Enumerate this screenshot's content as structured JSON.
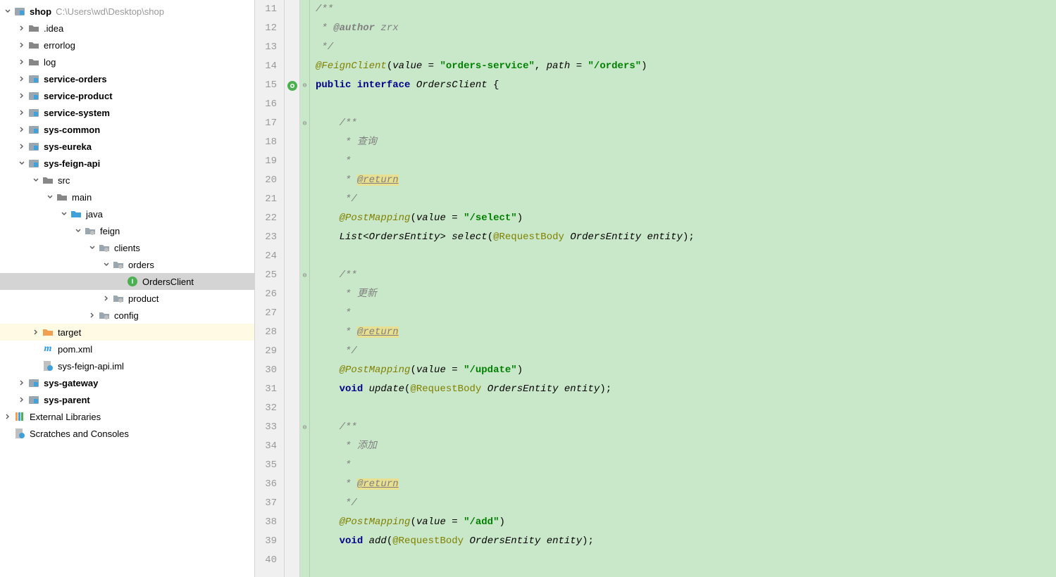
{
  "tree": {
    "root": {
      "name": "shop",
      "path": "C:\\Users\\wd\\Desktop\\shop"
    },
    "items": [
      {
        "indent": 0,
        "chev": "down",
        "icon": "module",
        "label": "shop",
        "bold": true,
        "path": "C:\\Users\\wd\\Desktop\\shop"
      },
      {
        "indent": 1,
        "chev": "right",
        "icon": "folder-grey",
        "label": ".idea"
      },
      {
        "indent": 1,
        "chev": "right",
        "icon": "folder-grey",
        "label": "errorlog"
      },
      {
        "indent": 1,
        "chev": "right",
        "icon": "folder-grey",
        "label": "log"
      },
      {
        "indent": 1,
        "chev": "right",
        "icon": "module",
        "label": "service-orders",
        "bold": true
      },
      {
        "indent": 1,
        "chev": "right",
        "icon": "module",
        "label": "service-product",
        "bold": true
      },
      {
        "indent": 1,
        "chev": "right",
        "icon": "module",
        "label": "service-system",
        "bold": true
      },
      {
        "indent": 1,
        "chev": "right",
        "icon": "module",
        "label": "sys-common",
        "bold": true
      },
      {
        "indent": 1,
        "chev": "right",
        "icon": "module",
        "label": "sys-eureka",
        "bold": true
      },
      {
        "indent": 1,
        "chev": "down",
        "icon": "module",
        "label": "sys-feign-api",
        "bold": true
      },
      {
        "indent": 2,
        "chev": "down",
        "icon": "folder-grey",
        "label": "src"
      },
      {
        "indent": 3,
        "chev": "down",
        "icon": "folder-grey",
        "label": "main"
      },
      {
        "indent": 4,
        "chev": "down",
        "icon": "folder-blue",
        "label": "java"
      },
      {
        "indent": 5,
        "chev": "down",
        "icon": "package",
        "label": "feign"
      },
      {
        "indent": 6,
        "chev": "down",
        "icon": "package",
        "label": "clients"
      },
      {
        "indent": 7,
        "chev": "down",
        "icon": "package",
        "label": "orders"
      },
      {
        "indent": 8,
        "chev": "blank",
        "icon": "interface",
        "label": "OrdersClient",
        "selected": true
      },
      {
        "indent": 7,
        "chev": "right",
        "icon": "package",
        "label": "product"
      },
      {
        "indent": 6,
        "chev": "right",
        "icon": "package",
        "label": "config"
      },
      {
        "indent": 2,
        "chev": "right",
        "icon": "folder-orange",
        "label": "target",
        "targetHl": true
      },
      {
        "indent": 2,
        "chev": "blank",
        "icon": "maven",
        "label": "pom.xml"
      },
      {
        "indent": 2,
        "chev": "blank",
        "icon": "iml",
        "label": "sys-feign-api.iml"
      },
      {
        "indent": 1,
        "chev": "right",
        "icon": "module",
        "label": "sys-gateway",
        "bold": true
      },
      {
        "indent": 1,
        "chev": "right",
        "icon": "module",
        "label": "sys-parent",
        "bold": true
      },
      {
        "indent": 0,
        "chev": "right",
        "icon": "library",
        "label": "External Libraries"
      },
      {
        "indent": 0,
        "chev": "blank",
        "icon": "scratch",
        "label": "Scratches and Consoles"
      }
    ]
  },
  "editor": {
    "startLine": 11,
    "lines": [
      {
        "n": 11,
        "html": "<span class='c'>/**</span>"
      },
      {
        "n": 12,
        "html": "<span class='c'> * </span><span class='ct'>@author</span><span class='c'> zrx</span>"
      },
      {
        "n": 13,
        "html": "<span class='c'> */</span>"
      },
      {
        "n": 14,
        "html": "<span class='ani'>@FeignClient</span><span class='p'>(</span><span class='id'>value</span><span class='p'> = </span><span class='s'>\"orders-service\"</span><span class='p'>, </span><span class='id'>path</span><span class='p'> = </span><span class='s'>\"/orders\"</span><span class='p'>)</span>"
      },
      {
        "n": 15,
        "html": "<span class='k'>public interface</span><span class='p'> </span><span class='id'>OrdersClient</span><span class='p'> {</span>",
        "gutterIcon": "impl"
      },
      {
        "n": 16,
        "html": ""
      },
      {
        "n": 17,
        "html": "    <span class='c'>/**</span>"
      },
      {
        "n": 18,
        "html": "    <span class='c'> * 查询</span>"
      },
      {
        "n": 19,
        "html": "    <span class='c'> *</span>"
      },
      {
        "n": 20,
        "html": "    <span class='c'> * </span><span class='ctag'>@return</span>"
      },
      {
        "n": 21,
        "html": "    <span class='c'> */</span>"
      },
      {
        "n": 22,
        "html": "    <span class='ani'>@PostMapping</span><span class='p'>(</span><span class='id'>value</span><span class='p'> = </span><span class='s'>\"/select\"</span><span class='p'>)</span>"
      },
      {
        "n": 23,
        "html": "    <span class='id'>List</span><span class='p'>&lt;</span><span class='id'>OrdersEntity</span><span class='p'>&gt; </span><span class='id'>select</span><span class='p'>(</span><span class='an'>@RequestBody</span><span class='p'> </span><span class='id'>OrdersEntity entity</span><span class='p'>);</span>"
      },
      {
        "n": 24,
        "html": ""
      },
      {
        "n": 25,
        "html": "    <span class='c'>/**</span>"
      },
      {
        "n": 26,
        "html": "    <span class='c'> * 更新</span>"
      },
      {
        "n": 27,
        "html": "    <span class='c'> *</span>"
      },
      {
        "n": 28,
        "html": "    <span class='c'> * </span><span class='ctag'>@return</span>"
      },
      {
        "n": 29,
        "html": "    <span class='c'> */</span>"
      },
      {
        "n": 30,
        "html": "    <span class='ani'>@PostMapping</span><span class='p'>(</span><span class='id'>value</span><span class='p'> = </span><span class='s'>\"/update\"</span><span class='p'>)</span>"
      },
      {
        "n": 31,
        "html": "    <span class='k'>void</span><span class='p'> </span><span class='id'>update</span><span class='p'>(</span><span class='an'>@RequestBody</span><span class='p'> </span><span class='id'>OrdersEntity entity</span><span class='p'>);</span>"
      },
      {
        "n": 32,
        "html": ""
      },
      {
        "n": 33,
        "html": "    <span class='c'>/**</span>"
      },
      {
        "n": 34,
        "html": "    <span class='c'> * 添加</span>"
      },
      {
        "n": 35,
        "html": "    <span class='c'> *</span>"
      },
      {
        "n": 36,
        "html": "    <span class='c'> * </span><span class='ctag'>@return</span>"
      },
      {
        "n": 37,
        "html": "    <span class='c'> */</span>"
      },
      {
        "n": 38,
        "html": "    <span class='ani'>@PostMapping</span><span class='p'>(</span><span class='id'>value</span><span class='p'> = </span><span class='s'>\"/add\"</span><span class='p'>)</span>"
      },
      {
        "n": 39,
        "html": "    <span class='k'>void</span><span class='p'> </span><span class='id'>add</span><span class='p'>(</span><span class='an'>@RequestBody</span><span class='p'> </span><span class='id'>OrdersEntity entity</span><span class='p'>);</span>"
      },
      {
        "n": 40,
        "html": ""
      }
    ],
    "foldMarks": {
      "15": "⊖",
      "17": "⊖",
      "25": "⊖",
      "33": "⊖"
    }
  }
}
